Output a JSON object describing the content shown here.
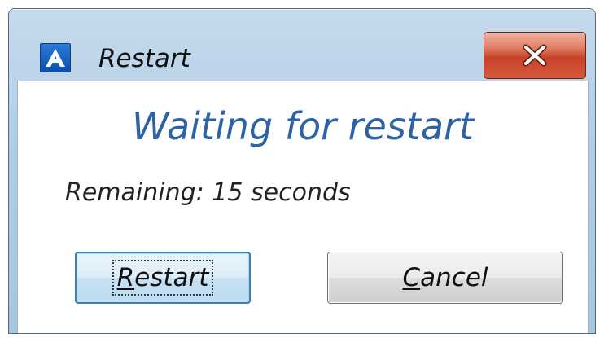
{
  "window": {
    "title": "Restart",
    "icon": "acronis-a-icon",
    "close_glyph": "✕"
  },
  "main": {
    "heading": "Waiting for restart",
    "remaining_text": "Remaining: 15 seconds"
  },
  "buttons": {
    "restart": {
      "mnemonic": "R",
      "rest": "estart"
    },
    "cancel": {
      "mnemonic": "C",
      "rest": "ancel"
    }
  },
  "colors": {
    "heading": "#2d63a5",
    "close_button": "#c7412a",
    "icon": "#0b4fae"
  }
}
